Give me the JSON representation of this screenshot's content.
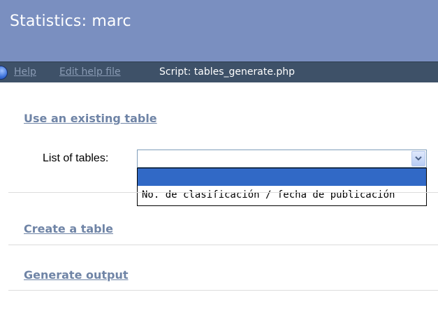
{
  "header": {
    "title": "Statistics: marc"
  },
  "nav": {
    "help_label": "Help",
    "edit_help_label": "Edit help file",
    "script_label": "Script: tables_generate.php"
  },
  "sections": {
    "existing_table": "Use an existing table",
    "create_table": "Create a table",
    "generate_output": "Generate output"
  },
  "form": {
    "list_label": "List of tables:",
    "selected_value": "",
    "options": [
      "",
      "No. de clasificación / fecha de publicación"
    ]
  },
  "colors": {
    "title_bg": "#7a8fc0",
    "nav_bg": "#3e5168",
    "link_color": "#6f84a6",
    "selected_option_bg": "#3169c6"
  }
}
